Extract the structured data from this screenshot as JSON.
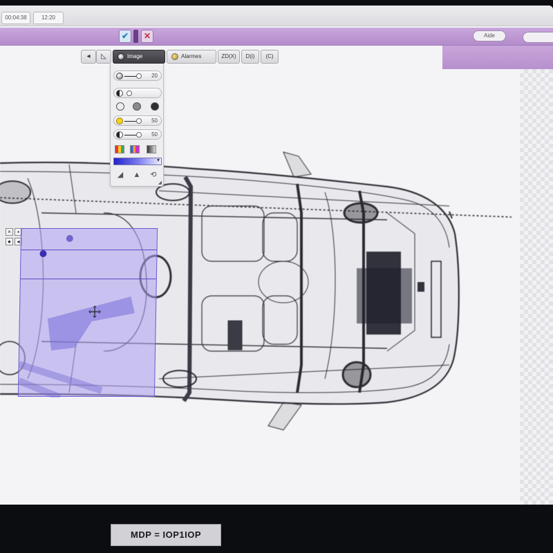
{
  "header": {
    "time_left": "00:04:38",
    "time_right": "12:20",
    "validate_icon": "check-icon",
    "reject_icon": "x-icon",
    "help_label": "Aide"
  },
  "tabs": [
    {
      "id": "back",
      "label": "",
      "icon": "arrow-left-icon"
    },
    {
      "id": "shape",
      "label": "",
      "icon": "triangle-icon"
    },
    {
      "id": "image",
      "label": "Image",
      "icon": "lens-icon",
      "active": true
    },
    {
      "id": "alarmes",
      "label": "Alarmes",
      "icon": "bulb-icon"
    },
    {
      "id": "zd",
      "label": "ZD(X)"
    },
    {
      "id": "d",
      "label": "D(i)"
    },
    {
      "id": "c",
      "label": "(C)"
    }
  ],
  "image_panel": {
    "contrast_value": "20",
    "brightness_value": "50",
    "gamma_value": "50",
    "shade_levels": [
      "light",
      "medium",
      "dark"
    ],
    "palettes": [
      "color",
      "rainbow",
      "grayscale"
    ],
    "gradient_colors": [
      "#2222cc",
      "#eeeeff"
    ],
    "tools": [
      "ramp-icon",
      "shape-icon",
      "reset-icon"
    ]
  },
  "zoom_selection": {
    "tools": [
      "close-icon",
      "lock-icon",
      "record-icon",
      "hide-icon"
    ],
    "cursor": "move-cursor-icon"
  },
  "colors": {
    "toolbar_purple": "#b38ccb",
    "selection_fill": "#afa0f0",
    "selection_border": "#6a5ccf"
  },
  "bezel_label": "MDP = IOP1IOP"
}
